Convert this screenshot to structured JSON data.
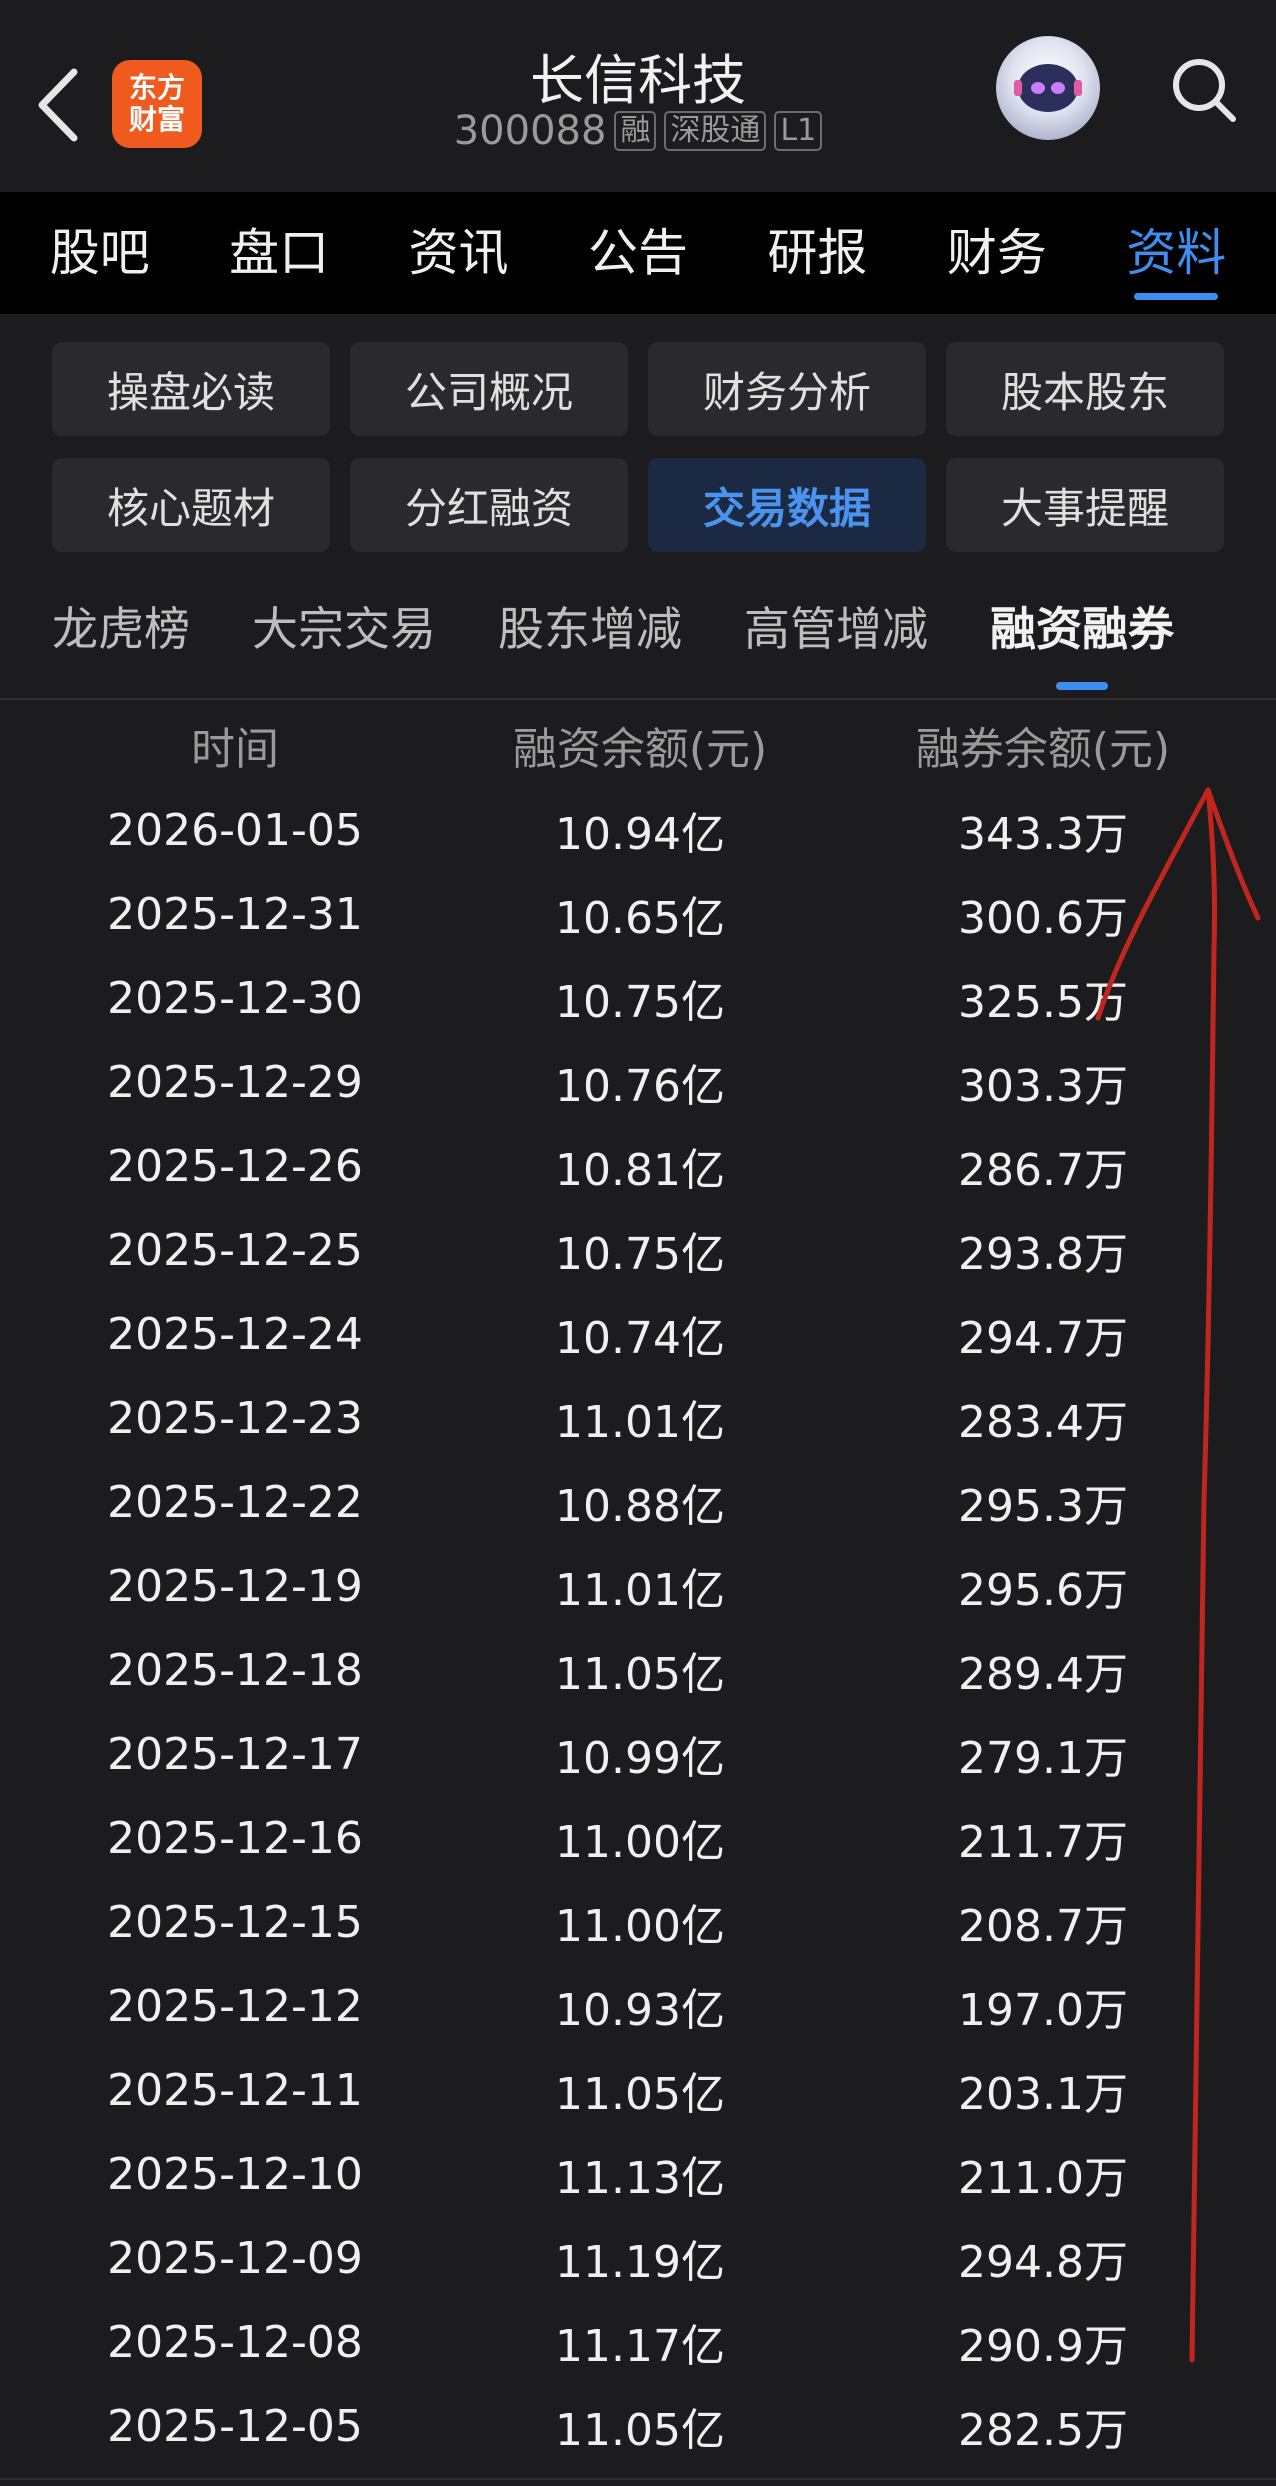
{
  "header": {
    "back_icon": "chevron-left-icon",
    "logo_line1": "东方",
    "logo_line2": "财富",
    "stock_name": "长信科技",
    "stock_code": "300088",
    "tags": [
      "融",
      "深股通",
      "L1"
    ],
    "avatar_icon": "robot-avatar-icon",
    "search_icon": "search-icon"
  },
  "main_tabs": [
    {
      "label": "股吧"
    },
    {
      "label": "盘口"
    },
    {
      "label": "资讯"
    },
    {
      "label": "公告"
    },
    {
      "label": "研报"
    },
    {
      "label": "财务"
    },
    {
      "label": "资料",
      "active": true
    }
  ],
  "grid_buttons": [
    {
      "label": "操盘必读"
    },
    {
      "label": "公司概况"
    },
    {
      "label": "财务分析"
    },
    {
      "label": "股本股东"
    },
    {
      "label": "核心题材"
    },
    {
      "label": "分红融资"
    },
    {
      "label": "交易数据",
      "active": true
    },
    {
      "label": "大事提醒"
    }
  ],
  "sub_tabs": [
    {
      "label": "龙虎榜"
    },
    {
      "label": "大宗交易"
    },
    {
      "label": "股东增减"
    },
    {
      "label": "高管增减"
    },
    {
      "label": "融资融券",
      "active": true
    }
  ],
  "table": {
    "headers": [
      "时间",
      "融资余额(元)",
      "融券余额(元)"
    ],
    "rows": [
      [
        "2026-01-05",
        "10.94亿",
        "343.3万"
      ],
      [
        "2025-12-31",
        "10.65亿",
        "300.6万"
      ],
      [
        "2025-12-30",
        "10.75亿",
        "325.5万"
      ],
      [
        "2025-12-29",
        "10.76亿",
        "303.3万"
      ],
      [
        "2025-12-26",
        "10.81亿",
        "286.7万"
      ],
      [
        "2025-12-25",
        "10.75亿",
        "293.8万"
      ],
      [
        "2025-12-24",
        "10.74亿",
        "294.7万"
      ],
      [
        "2025-12-23",
        "11.01亿",
        "283.4万"
      ],
      [
        "2025-12-22",
        "10.88亿",
        "295.3万"
      ],
      [
        "2025-12-19",
        "11.01亿",
        "295.6万"
      ],
      [
        "2025-12-18",
        "11.05亿",
        "289.4万"
      ],
      [
        "2025-12-17",
        "10.99亿",
        "279.1万"
      ],
      [
        "2025-12-16",
        "11.00亿",
        "211.7万"
      ],
      [
        "2025-12-15",
        "11.00亿",
        "208.7万"
      ],
      [
        "2025-12-12",
        "10.93亿",
        "197.0万"
      ],
      [
        "2025-12-11",
        "11.05亿",
        "203.1万"
      ],
      [
        "2025-12-10",
        "11.13亿",
        "211.0万"
      ],
      [
        "2025-12-09",
        "11.19亿",
        "294.8万"
      ],
      [
        "2025-12-08",
        "11.17亿",
        "290.9万"
      ],
      [
        "2025-12-05",
        "11.05亿",
        "282.5万"
      ]
    ]
  },
  "colors": {
    "accent": "#3d8ef0",
    "logo_orange": "#f05a1e",
    "annotation_red": "#c0261f",
    "background": "#1c1c1e"
  }
}
